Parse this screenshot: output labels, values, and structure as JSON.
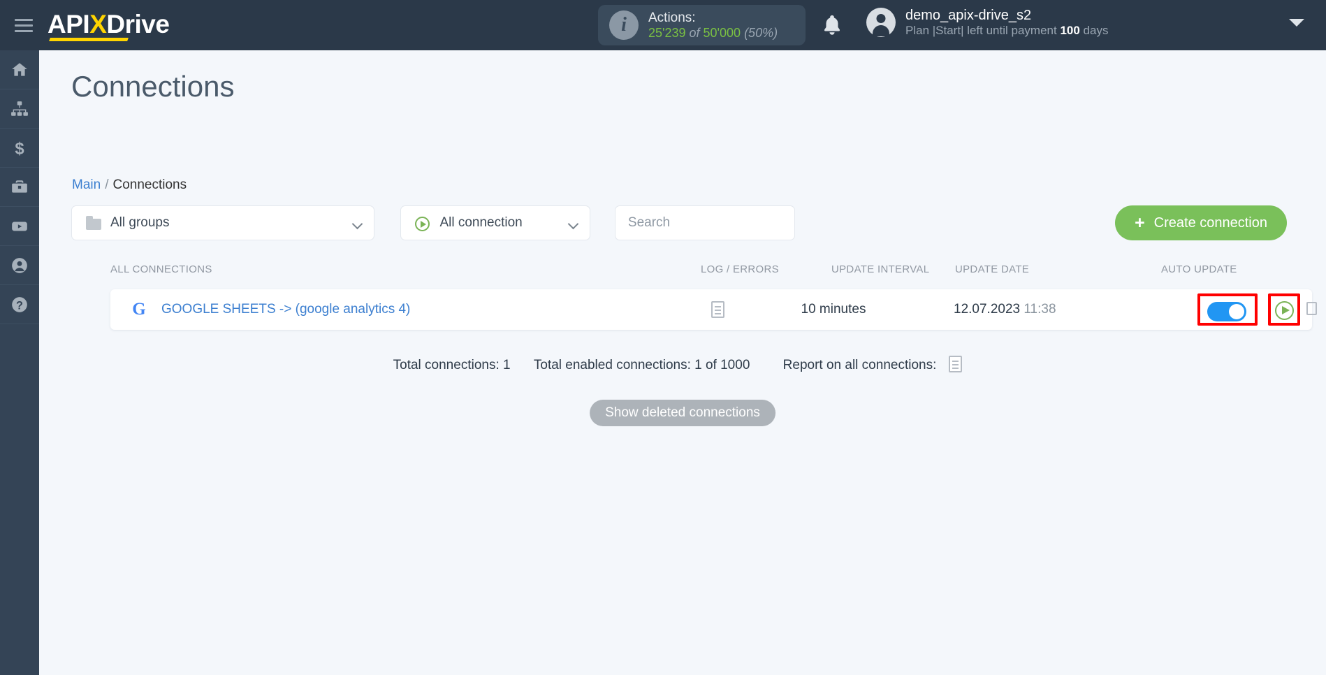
{
  "topbar": {
    "logo": {
      "part1": "API",
      "x": "X",
      "part2": "Drive"
    },
    "menu_icon": "hamburger-icon",
    "actions": {
      "title": "Actions:",
      "used": "25'239",
      "of": "of",
      "total": "50'000",
      "percent": "(50%)"
    },
    "user": {
      "name": "demo_apix-drive_s2",
      "plan_prefix": "Plan |Start| left until payment ",
      "plan_days": "100",
      "plan_suffix": " days"
    }
  },
  "leftnav": {
    "items": [
      {
        "name": "home",
        "icon": "home-icon"
      },
      {
        "name": "connections",
        "icon": "sitemap-icon"
      },
      {
        "name": "billing",
        "icon": "dollar-icon"
      },
      {
        "name": "business",
        "icon": "briefcase-icon"
      },
      {
        "name": "video",
        "icon": "youtube-icon"
      },
      {
        "name": "account",
        "icon": "user-icon"
      },
      {
        "name": "help",
        "icon": "question-icon"
      }
    ]
  },
  "page": {
    "title": "Connections",
    "breadcrumb": {
      "root": "Main",
      "separator": "/",
      "current": "Connections"
    }
  },
  "filters": {
    "groups": {
      "value": "All groups",
      "icon": "folder-icon"
    },
    "connection": {
      "value": "All connection",
      "icon": "play-circle-icon"
    },
    "search": {
      "value": "",
      "placeholder": "Search"
    },
    "create_button": {
      "label": "Create connection",
      "icon": "plus-icon",
      "color": "#7ac05a"
    }
  },
  "table": {
    "headers": {
      "all_connections": "ALL CONNECTIONS",
      "log_errors": "LOG / ERRORS",
      "update_interval": "UPDATE INTERVAL",
      "update_date": "UPDATE DATE",
      "auto_update": "AUTO UPDATE"
    },
    "rows": [
      {
        "service_icon": "google-icon",
        "service_letter": "G",
        "name": "GOOGLE SHEETS -> (google analytics 4)",
        "log_icon": "document-icon",
        "interval": "10 minutes",
        "date": "12.07.2023",
        "time": "11:38",
        "auto_update_on": true,
        "actions": [
          "run-icon",
          "copy-icon",
          "gear-icon",
          "trash-icon"
        ]
      }
    ]
  },
  "summary": {
    "total_connections": "Total connections: 1",
    "total_enabled": "Total enabled connections: 1 of 1000",
    "report_label": "Report on all connections:",
    "report_icon": "document-icon"
  },
  "show_deleted_button": {
    "label": "Show deleted connections"
  },
  "highlights": [
    {
      "name": "auto-update-toggle-highlight",
      "color": "#ff0000"
    },
    {
      "name": "run-button-highlight",
      "color": "#ff0000"
    }
  ]
}
